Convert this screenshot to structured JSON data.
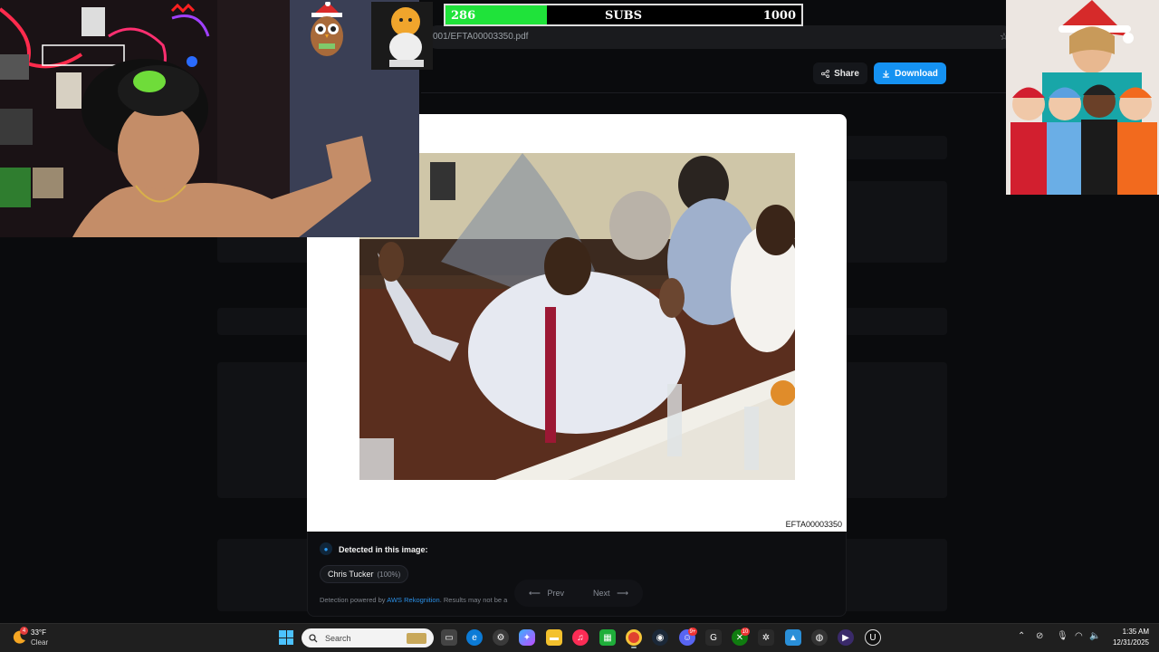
{
  "browser": {
    "address_text": "001/EFTA00003350.pdf",
    "share_label": "Share",
    "download_label": "Download"
  },
  "document": {
    "doc_id": "EFTA00003350"
  },
  "detection": {
    "title": "Detected in this image:",
    "person_name": "Chris Tucker",
    "confidence": "(100%)",
    "powered_prefix": "Detection powered by ",
    "powered_link": "AWS Rekognition",
    "powered_suffix": ". Results may not be a"
  },
  "pager": {
    "prev_label": "Prev",
    "next_label": "Next"
  },
  "subs_goal": {
    "current": "286",
    "label": "SUBS",
    "goal": "1000",
    "progress": 0.286,
    "fill_color": "#1fe33a"
  },
  "taskbar": {
    "weather_temp": "33°F",
    "weather_condition": "Clear",
    "weather_badge": "4",
    "search_placeholder": "Search",
    "discord_badge": "9+",
    "xbox_badge": "10",
    "time": "1:35 AM",
    "date": "12/31/2025"
  },
  "colors": {
    "accent": "#1592f2",
    "background": "#0a0b0d"
  }
}
